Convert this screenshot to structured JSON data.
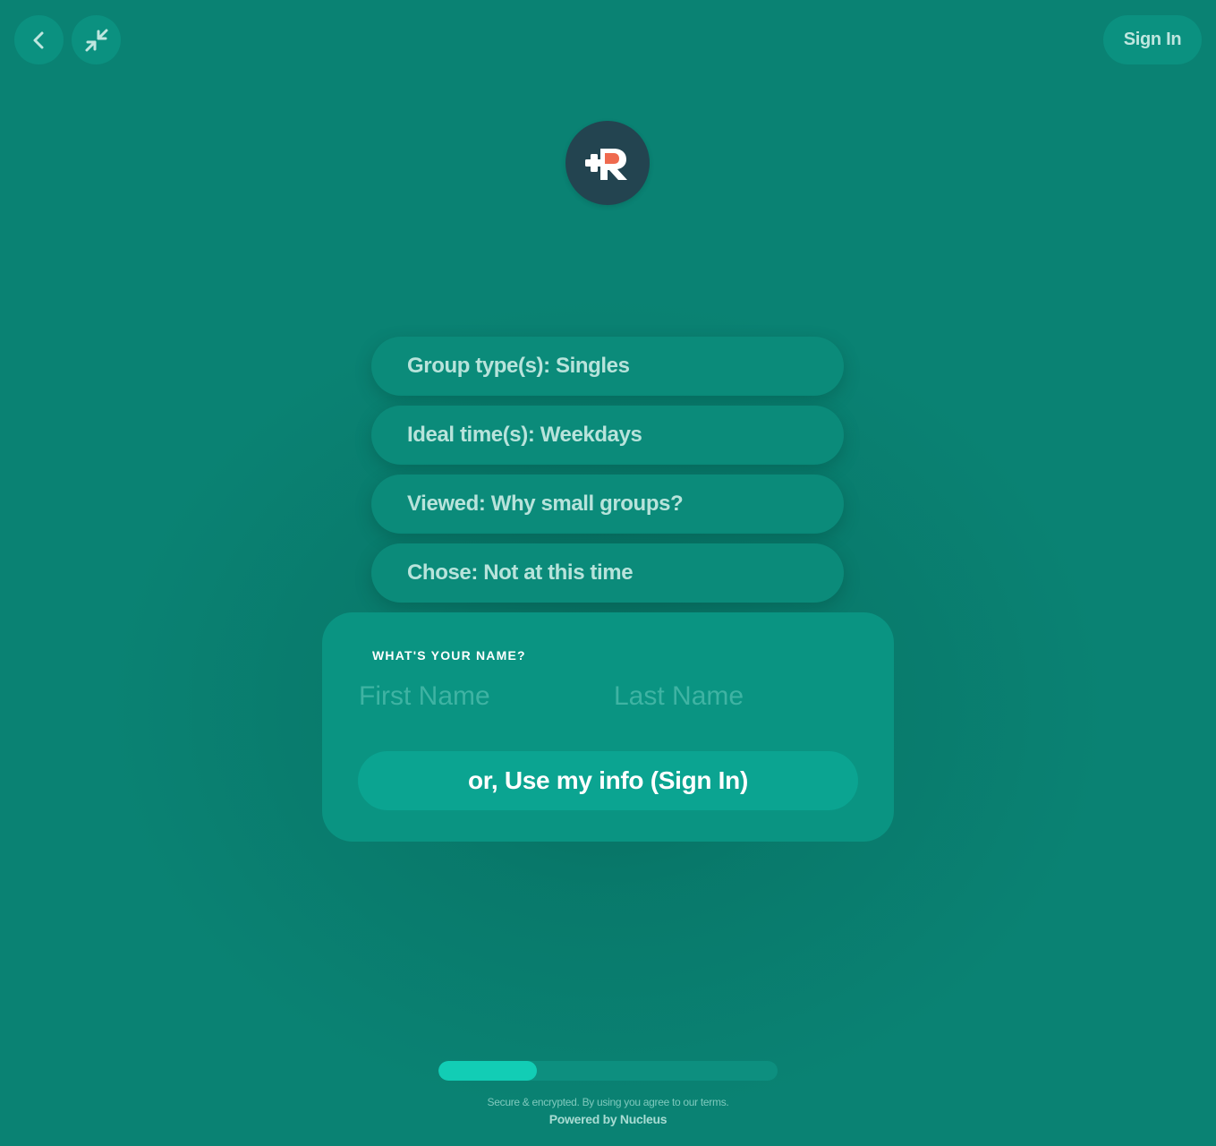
{
  "topbar": {
    "back_icon": "chevron-left-icon",
    "collapse_icon": "minimize-arrows-icon",
    "signin_label": "Sign In"
  },
  "logo": {
    "icon": "plus-r-logo",
    "colors": {
      "circle": "#234450",
      "letter": "#ffffff",
      "accent": "#ef6a4f"
    }
  },
  "answers": [
    {
      "label": "Group type(s): Singles"
    },
    {
      "label": "Ideal time(s): Weekdays"
    },
    {
      "label": "Viewed: Why small groups?"
    },
    {
      "label": "Chose: Not at this time"
    }
  ],
  "name_form": {
    "question": "WHAT'S YOUR NAME?",
    "first_name": {
      "value": "",
      "placeholder": "First Name"
    },
    "last_name": {
      "value": "",
      "placeholder": "Last Name"
    },
    "use_info_label": "or, Use my info (Sign In)"
  },
  "progress": {
    "fraction": 0.29
  },
  "footer": {
    "terms": "Secure & encrypted. By using you agree to our terms.",
    "powered_by": "Powered by Nucleus"
  },
  "colors": {
    "background": "#0a8273",
    "card": "#0a9482",
    "button": "#0ba491",
    "progress_fill": "#12cdb5"
  }
}
